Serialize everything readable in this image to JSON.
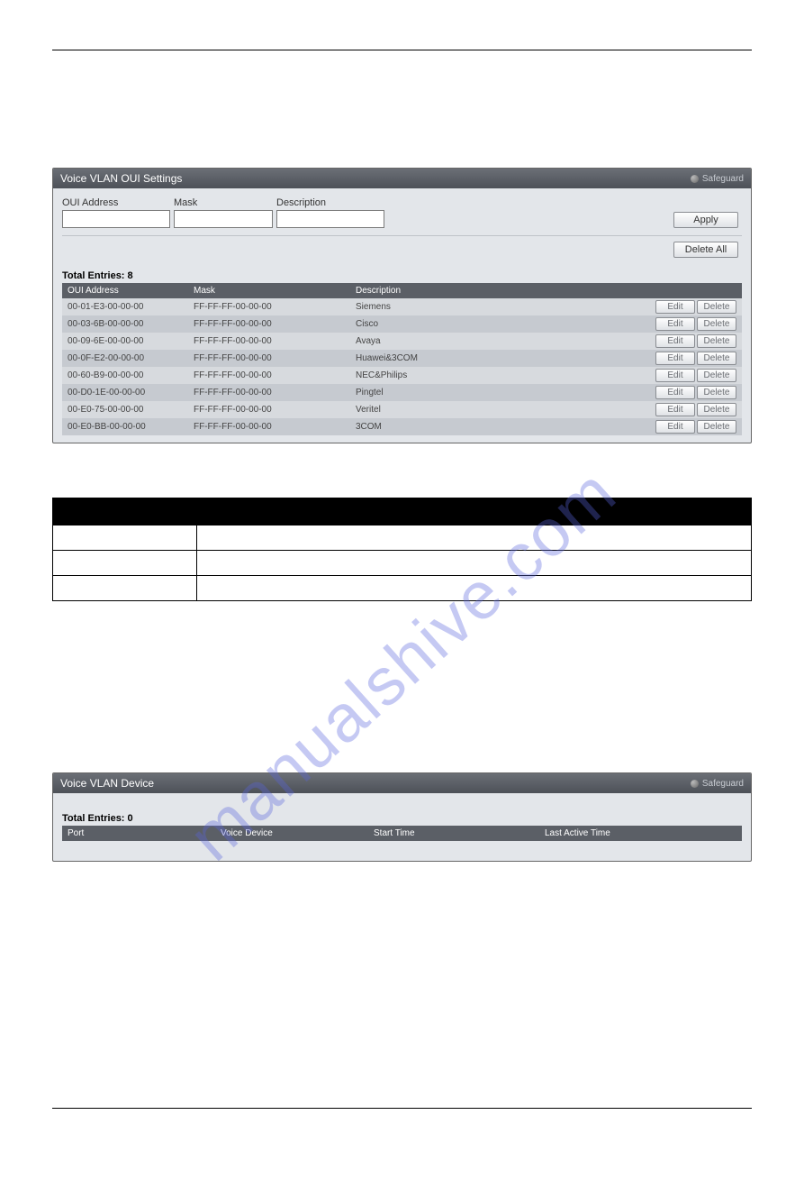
{
  "watermark": "manualshive.com",
  "panel1": {
    "title": "Voice VLAN OUI Settings",
    "safeguard": "Safeguard",
    "labels": {
      "oui_address": "OUI Address",
      "mask": "Mask",
      "description": "Description"
    },
    "buttons": {
      "apply": "Apply",
      "delete_all": "Delete All",
      "edit": "Edit",
      "delete": "Delete"
    },
    "entries_label": "Total Entries: 8",
    "columns": {
      "oui_address": "OUI Address",
      "mask": "Mask",
      "description": "Description"
    },
    "rows": [
      {
        "addr": "00-01-E3-00-00-00",
        "mask": "FF-FF-FF-00-00-00",
        "desc": "Siemens"
      },
      {
        "addr": "00-03-6B-00-00-00",
        "mask": "FF-FF-FF-00-00-00",
        "desc": "Cisco"
      },
      {
        "addr": "00-09-6E-00-00-00",
        "mask": "FF-FF-FF-00-00-00",
        "desc": "Avaya"
      },
      {
        "addr": "00-0F-E2-00-00-00",
        "mask": "FF-FF-FF-00-00-00",
        "desc": "Huawei&3COM"
      },
      {
        "addr": "00-60-B9-00-00-00",
        "mask": "FF-FF-FF-00-00-00",
        "desc": "NEC&Philips"
      },
      {
        "addr": "00-D0-1E-00-00-00",
        "mask": "FF-FF-FF-00-00-00",
        "desc": "Pingtel"
      },
      {
        "addr": "00-E0-75-00-00-00",
        "mask": "FF-FF-FF-00-00-00",
        "desc": "Veritel"
      },
      {
        "addr": "00-E0-BB-00-00-00",
        "mask": "FF-FF-FF-00-00-00",
        "desc": "3COM"
      }
    ]
  },
  "doc_table": {
    "header_parameter": "",
    "header_description": ""
  },
  "panel2": {
    "title": "Voice VLAN Device",
    "safeguard": "Safeguard",
    "entries_label": "Total Entries: 0",
    "columns": {
      "port": "Port",
      "voice_device": "Voice Device",
      "start_time": "Start Time",
      "last_active_time": "Last Active Time"
    }
  }
}
